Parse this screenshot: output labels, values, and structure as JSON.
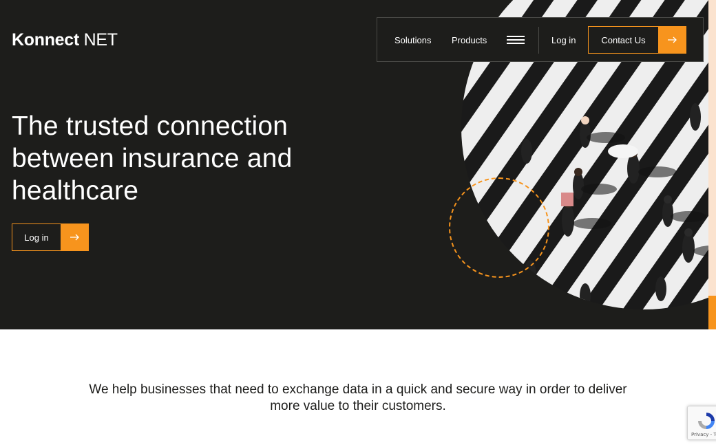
{
  "brand": {
    "name_bold": "Konnect",
    "name_light": "NET"
  },
  "nav": {
    "solutions": "Solutions",
    "products": "Products",
    "menu_icon": "hamburger-icon",
    "login": "Log in",
    "contact": "Contact Us"
  },
  "hero": {
    "headline": "The trusted connection between insurance and healthcare",
    "login_button": "Log in",
    "arrow_icon": "arrow-right-icon"
  },
  "tagline": {
    "line1": "We help businesses that need to exchange data in a quick and secure way in order to deliver",
    "line2": "more value to their customers."
  },
  "recaptcha": {
    "links": "Privacy - Terms"
  },
  "colors": {
    "background_dark": "#1d1d1b",
    "accent": "#f7941d",
    "text_dark": "#1d1d1b",
    "white": "#ffffff"
  }
}
